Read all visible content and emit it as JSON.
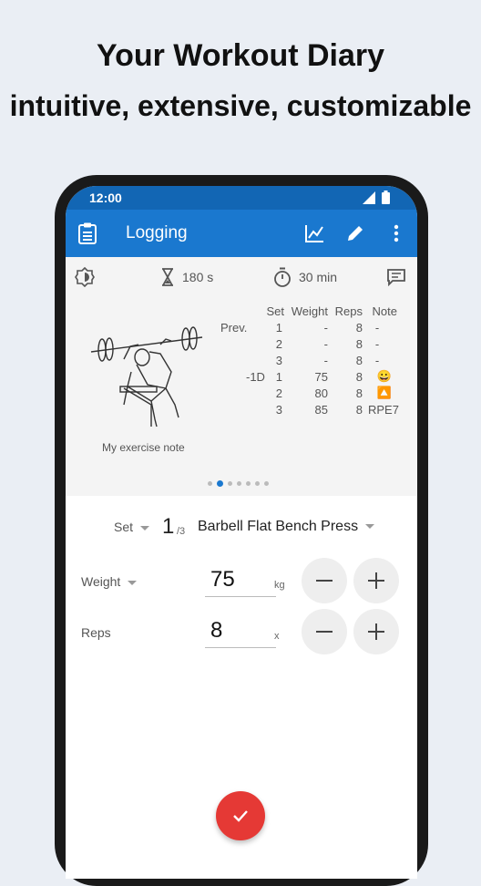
{
  "headline": {
    "line1": "Your Workout Diary",
    "line2": "intuitive, extensive, customizable"
  },
  "status_bar": {
    "time": "12:00"
  },
  "app_bar": {
    "title": "Logging",
    "icons": [
      "clipboard-list-icon",
      "chart-line-icon",
      "pencil-icon",
      "more-vert-icon"
    ]
  },
  "exercise_card": {
    "rest_timer": "180 s",
    "session_timer": "30 min",
    "table": {
      "headers": [
        "Set",
        "Weight",
        "Reps",
        "Note"
      ],
      "rows": [
        {
          "group": "Prev.",
          "set": "1",
          "weight": "-",
          "reps": "8",
          "note": "-"
        },
        {
          "group": "",
          "set": "2",
          "weight": "-",
          "reps": "8",
          "note": "-"
        },
        {
          "group": "",
          "set": "3",
          "weight": "-",
          "reps": "8",
          "note": "-"
        },
        {
          "group": "-1D",
          "set": "1",
          "weight": "75",
          "reps": "8",
          "note": "😀"
        },
        {
          "group": "",
          "set": "2",
          "weight": "80",
          "reps": "8",
          "note": "🔼"
        },
        {
          "group": "",
          "set": "3",
          "weight": "85",
          "reps": "8",
          "note": "RPE7"
        }
      ]
    },
    "exercise_note": "My exercise note",
    "page_count": 7,
    "active_page_index": 1
  },
  "form": {
    "set_label": "Set",
    "set_number": "1",
    "set_total": "/3",
    "exercise_name": "Barbell Flat Bench Press",
    "weight_label": "Weight",
    "weight_value": "75",
    "weight_unit": "kg",
    "reps_label": "Reps",
    "reps_value": "8",
    "reps_unit": "x"
  },
  "colors": {
    "primary": "#1a78cf",
    "status_bar": "#1266b4",
    "fab": "#e53935",
    "background": "#eaeef4"
  }
}
